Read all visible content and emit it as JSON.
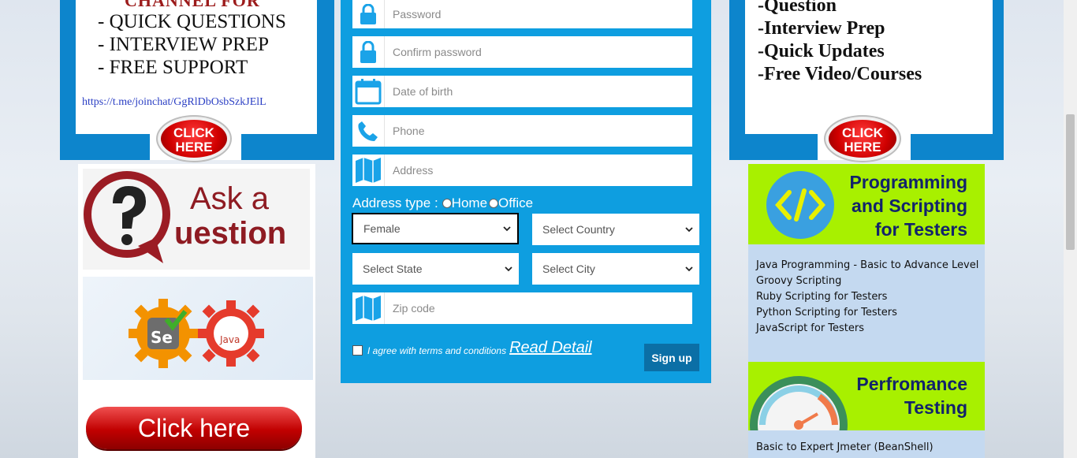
{
  "left_promo": {
    "channel_heading": "CHANNEL FOR",
    "items": [
      "- QUICK QUESTIONS",
      "- INTERVIEW PREP",
      "- FREE SUPPORT"
    ],
    "link": "https://t.me/joinchat/GgRlDbOsbSzkJElL",
    "badge": "CLICK HERE"
  },
  "left_ads": {
    "ask_line1": "Ask a",
    "ask_line2": "uestion",
    "se_label": "Se",
    "java_label": "Java",
    "click_here": "Click here"
  },
  "form": {
    "fields": {
      "password": "Password",
      "confirm_password": "Confirm password",
      "dob": "Date of birth",
      "phone": "Phone",
      "address": "Address",
      "zip": "Zip code"
    },
    "address_type_label": "Address type :",
    "address_options": [
      "Home",
      "Office"
    ],
    "selects": {
      "gender": "Female",
      "country": "Select Country",
      "state": "Select State",
      "city": "Select City"
    },
    "agree_text": "I agree with terms and conditions",
    "read_detail": "Read Detail",
    "signup": "Sign up"
  },
  "right_promo": {
    "items": [
      "-Question",
      "-Interview Prep",
      "-Quick Updates",
      "-Free Video/Courses"
    ],
    "badge": "CLICK HERE"
  },
  "right_ads": {
    "prog_title": [
      "Programming",
      "and Scripting",
      "for Testers"
    ],
    "prog_list": [
      "Java Programming - Basic to Advance Level",
      "Groovy Scripting",
      "Ruby Scripting for Testers",
      "Python Scripting for Testers",
      "JavaScript for Testers"
    ],
    "perf_title": [
      "Perfromance",
      "Testing"
    ],
    "perf_list": [
      "Basic to Expert Jmeter (BeanShell)"
    ]
  },
  "colors": {
    "form_blue": "#0e9ee0",
    "promo_blue": "#0d85cc",
    "green": "#a8f000",
    "navy_text": "#12236b"
  }
}
